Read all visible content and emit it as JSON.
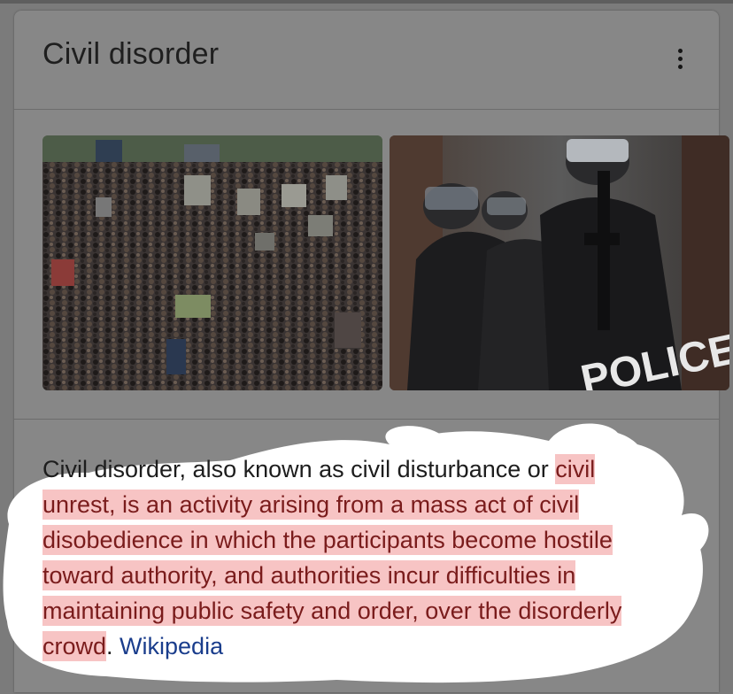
{
  "knowledge_panel": {
    "title": "Civil disorder",
    "more_icon": "more-vert-icon",
    "images": [
      {
        "alt": "crowd of protesters with signs",
        "icon": "crowd-photo"
      },
      {
        "alt": "riot police in helmets",
        "icon": "police-photo",
        "visible_text": "POLICE"
      }
    ],
    "description": {
      "plain": "Civil disorder, also known as civil disturbance or ",
      "highlighted": "civil unrest, is an activity arising from a mass act of civil disobedience in which the participants become hostile toward authority, and authorities incur difficulties in maintaining public safety and order, over the disorderly crowd",
      "after": ". ",
      "source_link": "Wikipedia"
    }
  },
  "colors": {
    "card": "#878787",
    "highlight": "#f7c4c4",
    "highlight_text": "#7a1c1c",
    "link": "#1a3d8c",
    "annotation": "#ffffff"
  }
}
